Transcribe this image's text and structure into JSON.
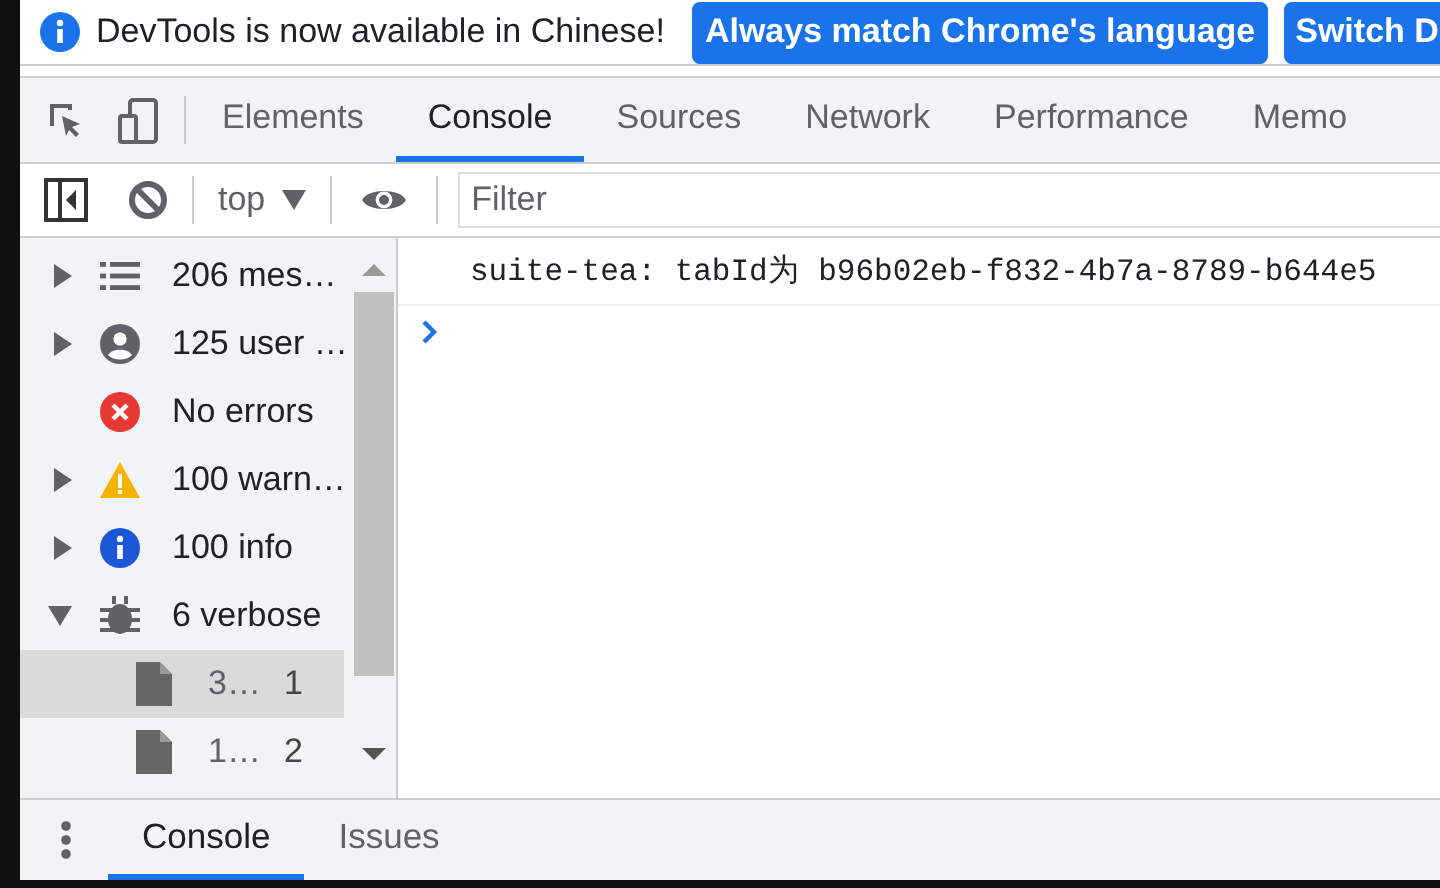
{
  "infobar": {
    "message": "DevTools is now available in Chinese!",
    "buttons": [
      "Always match Chrome's language",
      "Switch D"
    ]
  },
  "tabs": [
    {
      "label": "Elements",
      "selected": false
    },
    {
      "label": "Console",
      "selected": true
    },
    {
      "label": "Sources",
      "selected": false
    },
    {
      "label": "Network",
      "selected": false
    },
    {
      "label": "Performance",
      "selected": false
    },
    {
      "label": "Memo",
      "selected": false
    }
  ],
  "toolbar": {
    "context": "top",
    "filter": {
      "placeholder": "Filter"
    }
  },
  "sidebar": {
    "items": [
      {
        "kind": "list",
        "label": "206 mes…",
        "expanded": false
      },
      {
        "kind": "user",
        "label": "125 user …",
        "expanded": false
      },
      {
        "kind": "error",
        "label": "No errors"
      },
      {
        "kind": "warning",
        "label": "100 warn…",
        "expanded": false
      },
      {
        "kind": "info",
        "label": "100 info",
        "expanded": false
      },
      {
        "kind": "verbose",
        "label": "6 verbose",
        "expanded": true,
        "children": [
          {
            "kind": "file",
            "label": "3…",
            "count": "1",
            "selected": true
          },
          {
            "kind": "file",
            "label": "1…",
            "count": "2",
            "selected": false
          }
        ]
      }
    ]
  },
  "console": {
    "messages": [
      "suite-tea: tabId为 b96b02eb-f832-4b7a-8789-b644e5"
    ]
  },
  "drawer": {
    "tabs": [
      {
        "label": "Console",
        "selected": true
      },
      {
        "label": "Issues",
        "selected": false
      }
    ]
  }
}
